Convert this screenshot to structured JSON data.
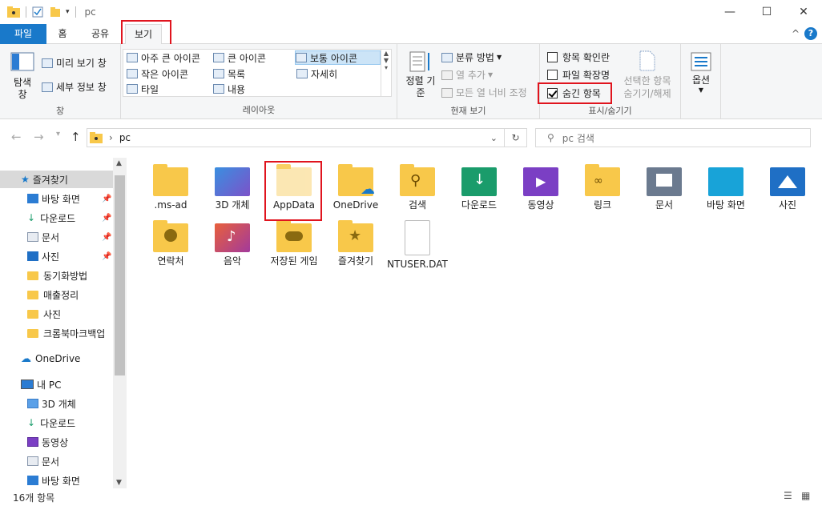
{
  "window": {
    "title": "pc"
  },
  "tabs": {
    "file": "파일",
    "home": "홈",
    "share": "공유",
    "view": "보기"
  },
  "ribbon": {
    "pane": {
      "nav_pane": "탐색 창",
      "preview": "미리 보기 창",
      "details": "세부 정보 창",
      "label": "창"
    },
    "layout": {
      "items": [
        "아주 큰 아이콘",
        "큰 아이콘",
        "보통 아이콘",
        "작은 아이콘",
        "목록",
        "자세히",
        "타일",
        "내용"
      ],
      "label": "레이아웃"
    },
    "current_view": {
      "sort": "정렬 기준",
      "group_by": "분류 방법",
      "add_columns": "열 추가",
      "fit_columns": "모든 열 너비 조정",
      "label": "현재 보기"
    },
    "show_hide": {
      "item_checkboxes": "항목 확인란",
      "file_extensions": "파일 확장명",
      "hidden_items": "숨긴 항목",
      "hide_selected": "선택한 항목 숨기기/해제",
      "label": "표시/숨기기",
      "item_checkboxes_checked": false,
      "file_extensions_checked": false,
      "hidden_items_checked": true
    },
    "options": "옵션"
  },
  "address": {
    "path_segment": "pc",
    "search_placeholder": "pc 검색"
  },
  "sidebar": {
    "quick_access": "즐겨찾기",
    "pinned": [
      "바탕 화면",
      "다운로드",
      "문서",
      "사진"
    ],
    "folders": [
      "동기화방법",
      "매출정리",
      "사진",
      "크롬북마크백업"
    ],
    "onedrive": "OneDrive",
    "this_pc": "내 PC",
    "pc_items": [
      "3D 개체",
      "다운로드",
      "동영상",
      "문서",
      "바탕 화면"
    ]
  },
  "files": [
    {
      "name": ".ms-ad",
      "icon": "folder-icon"
    },
    {
      "name": "3D 개체",
      "icon": "3d-objects-icon"
    },
    {
      "name": "AppData",
      "icon": "folder-hidden-icon"
    },
    {
      "name": "OneDrive",
      "icon": "onedrive-folder-icon"
    },
    {
      "name": "검색",
      "icon": "search-folder-icon"
    },
    {
      "name": "다운로드",
      "icon": "downloads-folder-icon"
    },
    {
      "name": "동영상",
      "icon": "videos-folder-icon"
    },
    {
      "name": "링크",
      "icon": "links-folder-icon"
    },
    {
      "name": "문서",
      "icon": "documents-folder-icon"
    },
    {
      "name": "바탕 화면",
      "icon": "desktop-folder-icon"
    },
    {
      "name": "사진",
      "icon": "pictures-folder-icon"
    },
    {
      "name": "연락처",
      "icon": "contacts-folder-icon"
    },
    {
      "name": "음악",
      "icon": "music-folder-icon"
    },
    {
      "name": "저장된 게임",
      "icon": "saved-games-folder-icon"
    },
    {
      "name": "즐겨찾기",
      "icon": "favorites-folder-icon"
    },
    {
      "name": "NTUSER.DAT",
      "icon": "file-icon"
    }
  ],
  "status": {
    "count": "16개 항목"
  }
}
